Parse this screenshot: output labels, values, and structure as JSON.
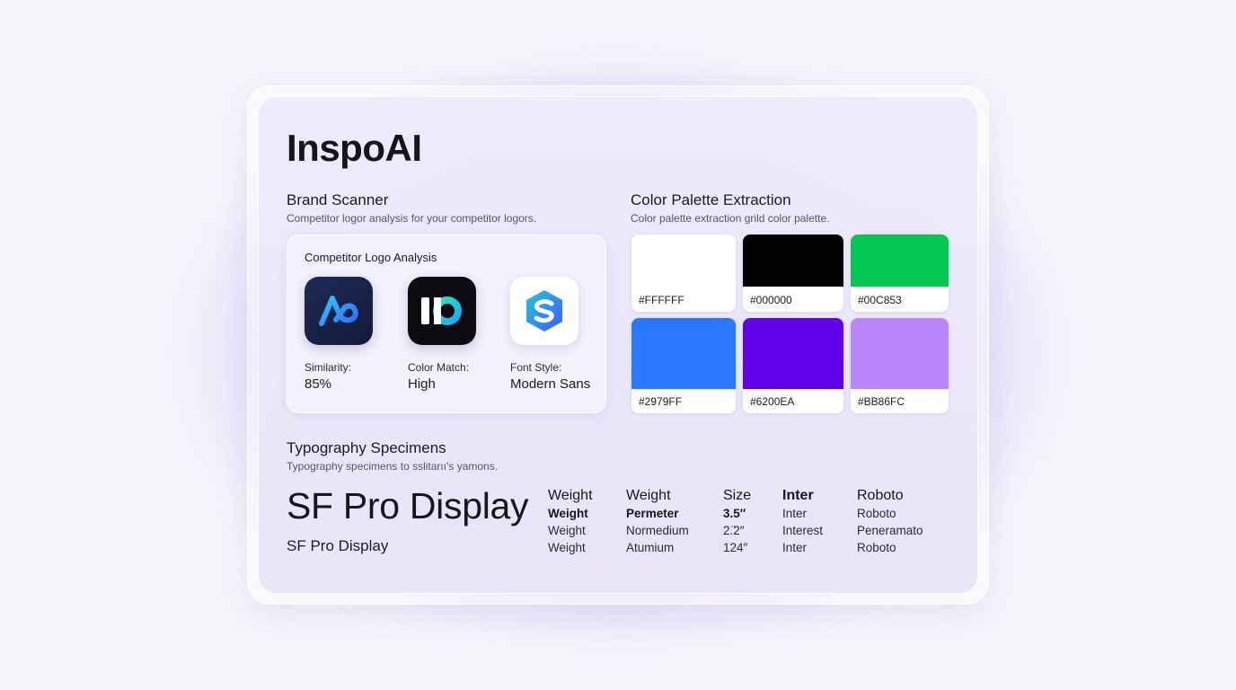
{
  "app": {
    "title": "InspoAI"
  },
  "brand_scanner": {
    "title": "Brand Scanner",
    "subtitle": "Competitor logor analysis for your competitor logors.",
    "panel_title": "Competitor Logo Analysis",
    "logos": [
      {
        "icon": "stylized-a-logo-icon",
        "label": "Similarity:",
        "value": "85%"
      },
      {
        "icon": "io-logo-icon",
        "label": "Color Match:",
        "value": "High"
      },
      {
        "icon": "hexagon-s-logo-icon",
        "label": "Font Style:",
        "value": "Modern Sans"
      }
    ]
  },
  "palette": {
    "title": "Color Palette Extraction",
    "subtitle": "Color palette extraction grild color palette.",
    "swatches": [
      {
        "hex": "#FFFFFF",
        "color": "#FFFFFF"
      },
      {
        "hex": "#000000",
        "color": "#000000"
      },
      {
        "hex": "#00C853",
        "color": "#00C853"
      },
      {
        "hex": "#2979FF",
        "color": "#2979FF"
      },
      {
        "hex": "#6200EA",
        "color": "#6200EA"
      },
      {
        "hex": "#BB86FC",
        "color": "#BB86FC"
      }
    ]
  },
  "typography": {
    "title": "Typography Specimens",
    "subtitle": "Typography specimens to sslitarıı's yamons.",
    "specimen_large": "SF Pro Display",
    "specimen_medium": "SF Pro Display",
    "columns": [
      {
        "header": "Weight",
        "rows": [
          "Weight",
          "Weight",
          "Weight"
        ]
      },
      {
        "header": "Weight",
        "rows": [
          "Permeter",
          "Normedium",
          "Atumium"
        ]
      },
      {
        "header": "Size",
        "rows": [
          "3.5″",
          "2.̈2″",
          "124″"
        ]
      },
      {
        "header": "Inter",
        "rows": [
          "Inter",
          "Interest",
          "Inter"
        ]
      },
      {
        "header": "Roboto",
        "rows": [
          "Roboto",
          "Peneramato",
          "Roboto"
        ]
      }
    ]
  }
}
